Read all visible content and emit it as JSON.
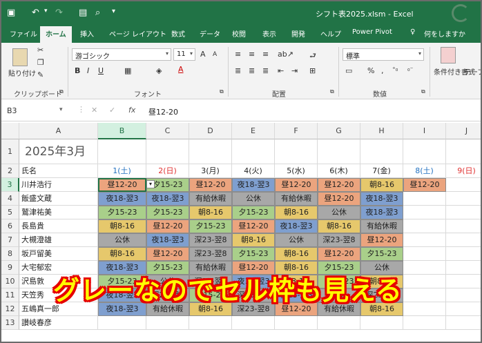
{
  "window": {
    "title": "シフト表2025.xlsm  -  Excel"
  },
  "tabs": [
    "ファイル",
    "ホーム",
    "挿入",
    "ページ レイアウト",
    "数式",
    "データ",
    "校閲",
    "表示",
    "開発",
    "ヘルプ",
    "Power Pivot",
    "何をしますか"
  ],
  "ribbon": {
    "paste_label": "貼り付け",
    "font_name": "游ゴシック",
    "font_size": "11",
    "number_format": "標準",
    "conditional_label": "条件付き書式",
    "table_label": "テーブル",
    "groups": {
      "clipboard": "クリップボード",
      "font": "フォント",
      "alignment": "配置",
      "number": "数値"
    }
  },
  "formula_bar": {
    "name_box": "B3",
    "fx": "fx",
    "content": "昼12-20"
  },
  "sheet": {
    "col_headers": [
      "A",
      "B",
      "C",
      "D",
      "E",
      "F",
      "G",
      "H",
      "I",
      "J"
    ],
    "row_headers": [
      "1",
      "2",
      "3",
      "4",
      "5",
      "6",
      "7",
      "8",
      "9",
      "10",
      "11",
      "12",
      "13"
    ],
    "title": "2025年3月",
    "name_header": "氏名",
    "dates": [
      {
        "label": "1(土)",
        "color": "#1f6fbf"
      },
      {
        "label": "2(日)",
        "color": "#e03030"
      },
      {
        "label": "3(月)",
        "color": "#222222"
      },
      {
        "label": "4(火)",
        "color": "#222222"
      },
      {
        "label": "5(水)",
        "color": "#222222"
      },
      {
        "label": "6(木)",
        "color": "#222222"
      },
      {
        "label": "7(金)",
        "color": "#222222"
      },
      {
        "label": "8(土)",
        "color": "#1f6fbf"
      },
      {
        "label": "9(日)",
        "color": "#e03030"
      }
    ],
    "names": [
      "川井浩行",
      "飯盛文蔵",
      "鷲津祐美",
      "長島貴",
      "大槻澄雄",
      "坂戸留美",
      "大宅郁宏",
      "沢島敦",
      "天笠秀",
      "五嶋真一郎",
      "讃岐春彦"
    ],
    "rows": [
      [
        "昼12-20",
        "夕15-23",
        "昼12-20",
        "夜18-翌3",
        "昼12-20",
        "昼12-20",
        "朝8-16",
        "昼12-20"
      ],
      [
        "夜18-翌3",
        "夜18-翌3",
        "有給休暇",
        "公休",
        "有給休暇",
        "昼12-20",
        "夜18-翌3"
      ],
      [
        "夕15-23",
        "夕15-23",
        "朝8-16",
        "夕15-23",
        "朝8-16",
        "公休",
        "夜18-翌3"
      ],
      [
        "朝8-16",
        "昼12-20",
        "夕15-23",
        "昼12-20",
        "夜18-翌3",
        "朝8-16",
        "有給休暇"
      ],
      [
        "公休",
        "夜18-翌3",
        "深23-翌8",
        "朝8-16",
        "公休",
        "深23-翌8",
        "昼12-20"
      ],
      [
        "朝8-16",
        "昼12-20",
        "深23-翌8",
        "夕15-23",
        "朝8-16",
        "昼12-20",
        "夕15-23"
      ],
      [
        "夜18-翌3",
        "夕15-23",
        "有給休暇",
        "昼12-20",
        "朝8-16",
        "夕15-23",
        "公休"
      ],
      [
        "夕15-23",
        "公休",
        "深23-翌8",
        "夜18-翌3",
        "朝8-16",
        "夕15-23",
        "朝8-16"
      ],
      [
        "夜18-翌3",
        "深23-翌8",
        "夕15-23",
        "深23-翌8",
        "夜18-翌3",
        "公休",
        "深23-翌8"
      ],
      [
        "夜18-翌3",
        "有給休暇",
        "朝8-16",
        "深23-翌8",
        "昼12-20",
        "有給休暇",
        "朝8-16"
      ],
      []
    ],
    "shift_colors": {
      "朝": "#e6c86c",
      "昼": "#eba47e",
      "夕": "#a9cf8a",
      "夜": "#7f9fcf",
      "深": "#a8a8a8",
      "公": "#a8a8a8",
      "有": "#a8a8a8"
    }
  },
  "overlay_text": "グレーなのでセル枠も見える"
}
